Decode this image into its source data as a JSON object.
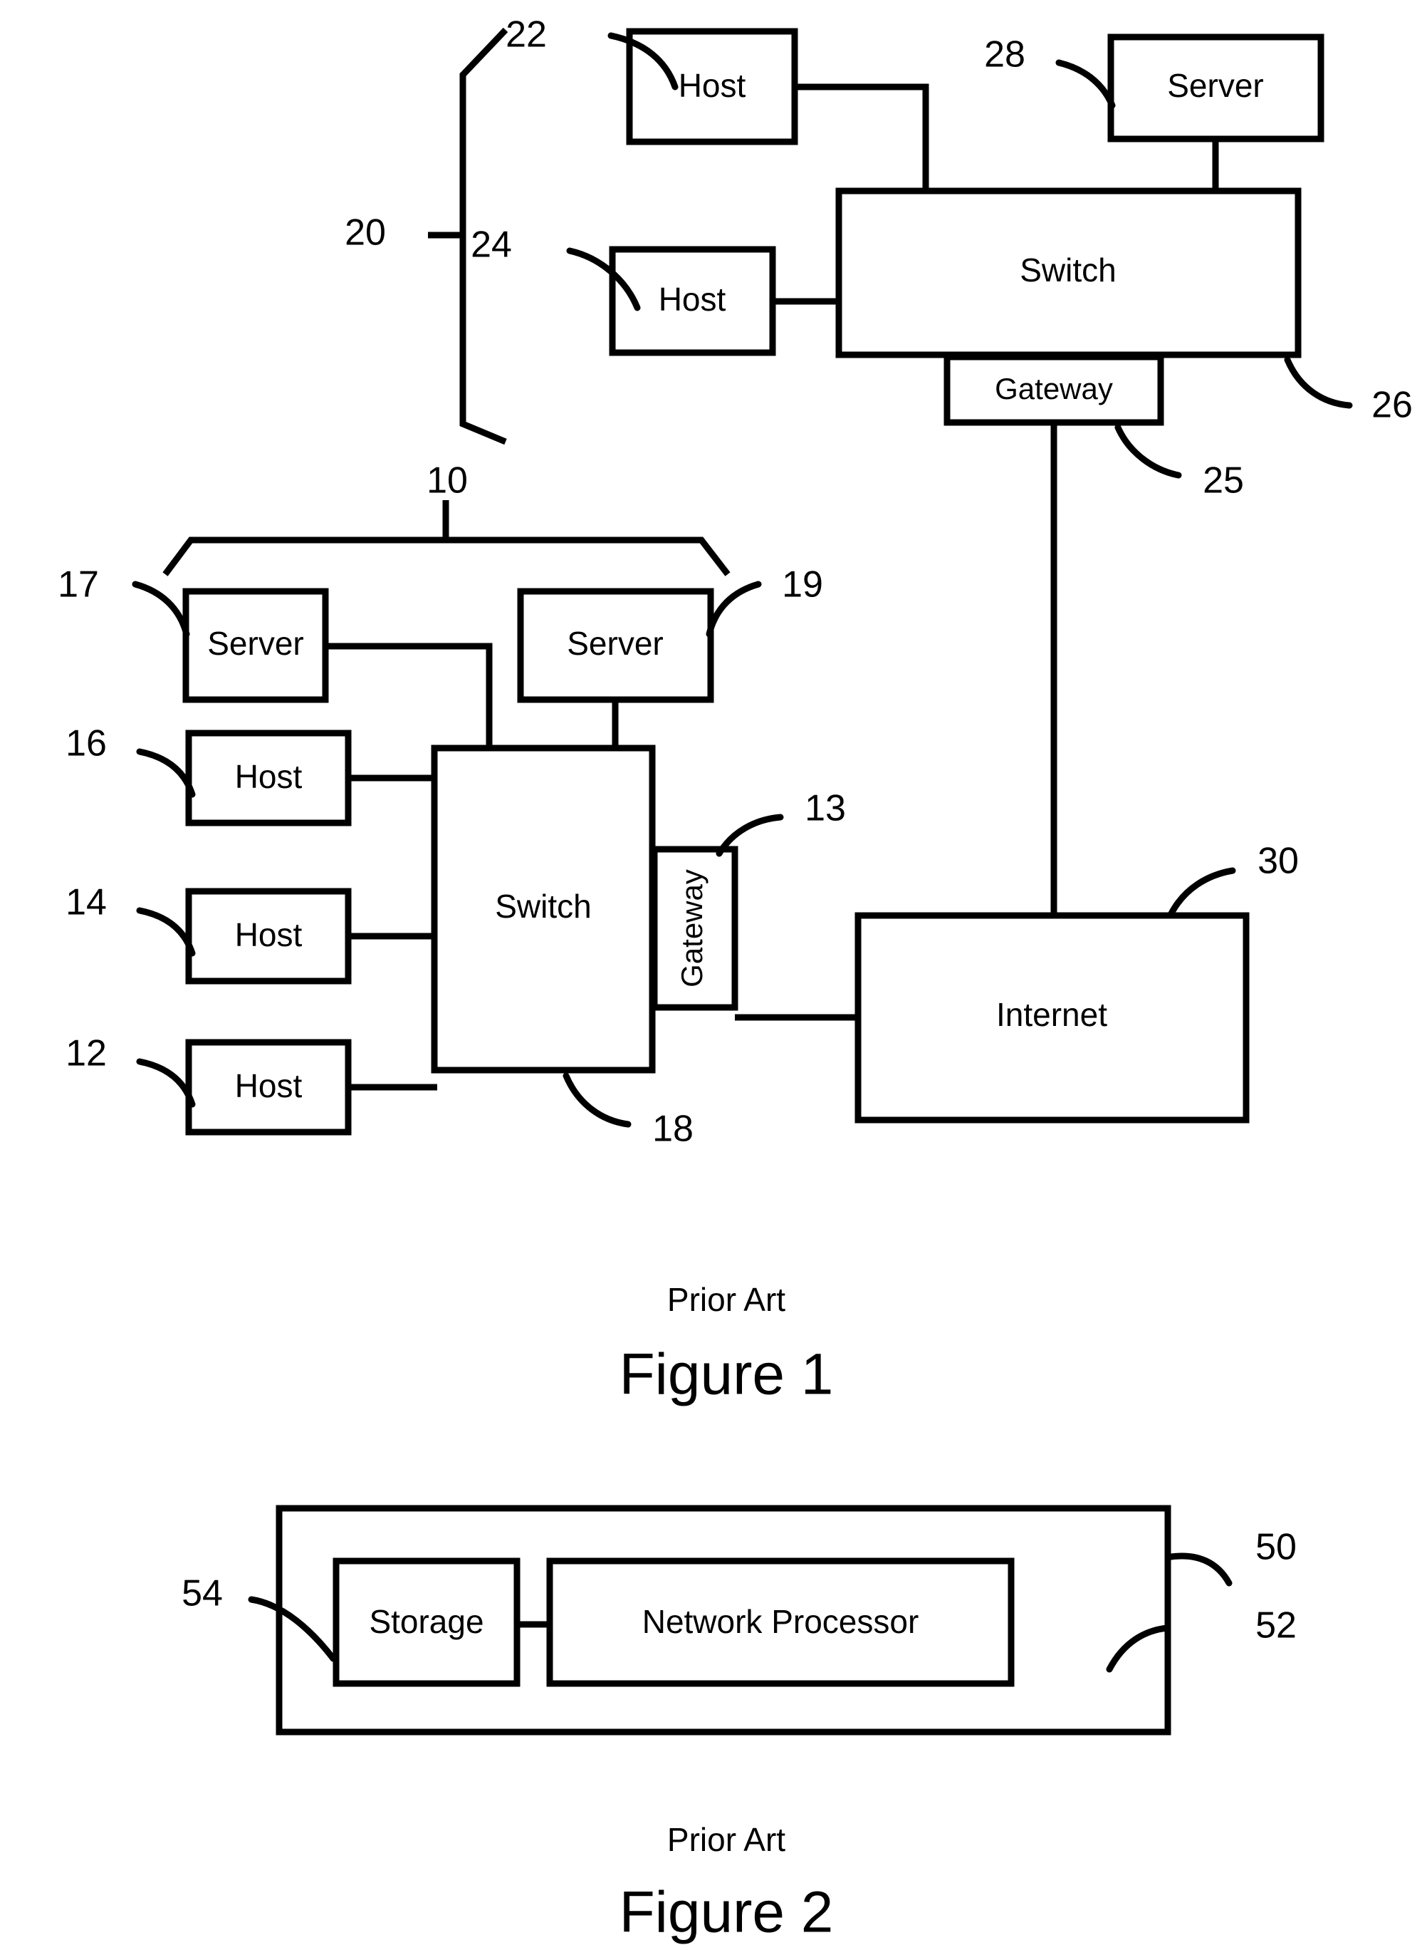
{
  "document": {
    "type": "patent-drawing-sheet",
    "figures": [
      {
        "id": "figure-1",
        "prior_art_label": "Prior Art",
        "caption": "Figure 1",
        "group_brackets": [
          {
            "ref": "20",
            "label": "20"
          },
          {
            "ref": "10",
            "label": "10"
          }
        ],
        "nodes": [
          {
            "ref": "22",
            "label": "Host"
          },
          {
            "ref": "24",
            "label": "Host"
          },
          {
            "ref": "28",
            "label": "Server"
          },
          {
            "ref": "26",
            "label": "Switch"
          },
          {
            "ref": "25",
            "label": "Gateway"
          },
          {
            "ref": "17",
            "label": "Server"
          },
          {
            "ref": "19",
            "label": "Server"
          },
          {
            "ref": "16",
            "label": "Host"
          },
          {
            "ref": "14",
            "label": "Host"
          },
          {
            "ref": "12",
            "label": "Host"
          },
          {
            "ref": "18",
            "label": "Switch"
          },
          {
            "ref": "13",
            "label": "Gateway"
          },
          {
            "ref": "30",
            "label": "Internet"
          }
        ]
      },
      {
        "id": "figure-2",
        "prior_art_label": "Prior Art",
        "caption": "Figure 2",
        "nodes": [
          {
            "ref": "50",
            "label": ""
          },
          {
            "ref": "52",
            "label": ""
          },
          {
            "ref": "54",
            "label": "Storage"
          },
          {
            "ref": "52b",
            "label": "Network Processor"
          }
        ]
      }
    ]
  },
  "figure1": {
    "ref_20": "20",
    "ref_22": "22",
    "ref_24": "24",
    "ref_28": "28",
    "ref_26": "26",
    "ref_25": "25",
    "ref_10": "10",
    "ref_17": "17",
    "ref_19": "19",
    "ref_16": "16",
    "ref_14": "14",
    "ref_12": "12",
    "ref_18": "18",
    "ref_13": "13",
    "ref_30": "30",
    "host_22": "Host",
    "host_24": "Host",
    "server_28": "Server",
    "switch_26": "Switch",
    "gateway_25": "Gateway",
    "server_17": "Server",
    "server_19": "Server",
    "host_16": "Host",
    "host_14": "Host",
    "host_12": "Host",
    "switch_18": "Switch",
    "gateway_13": "Gateway",
    "internet_30": "Internet",
    "prior_art": "Prior Art",
    "caption": "Figure 1"
  },
  "figure2": {
    "ref_50": "50",
    "ref_52": "52",
    "ref_54": "54",
    "storage": "Storage",
    "network_processor": "Network Processor",
    "prior_art": "Prior Art",
    "caption": "Figure 2"
  },
  "colors": {
    "ink": "#000000",
    "paper": "#ffffff"
  }
}
